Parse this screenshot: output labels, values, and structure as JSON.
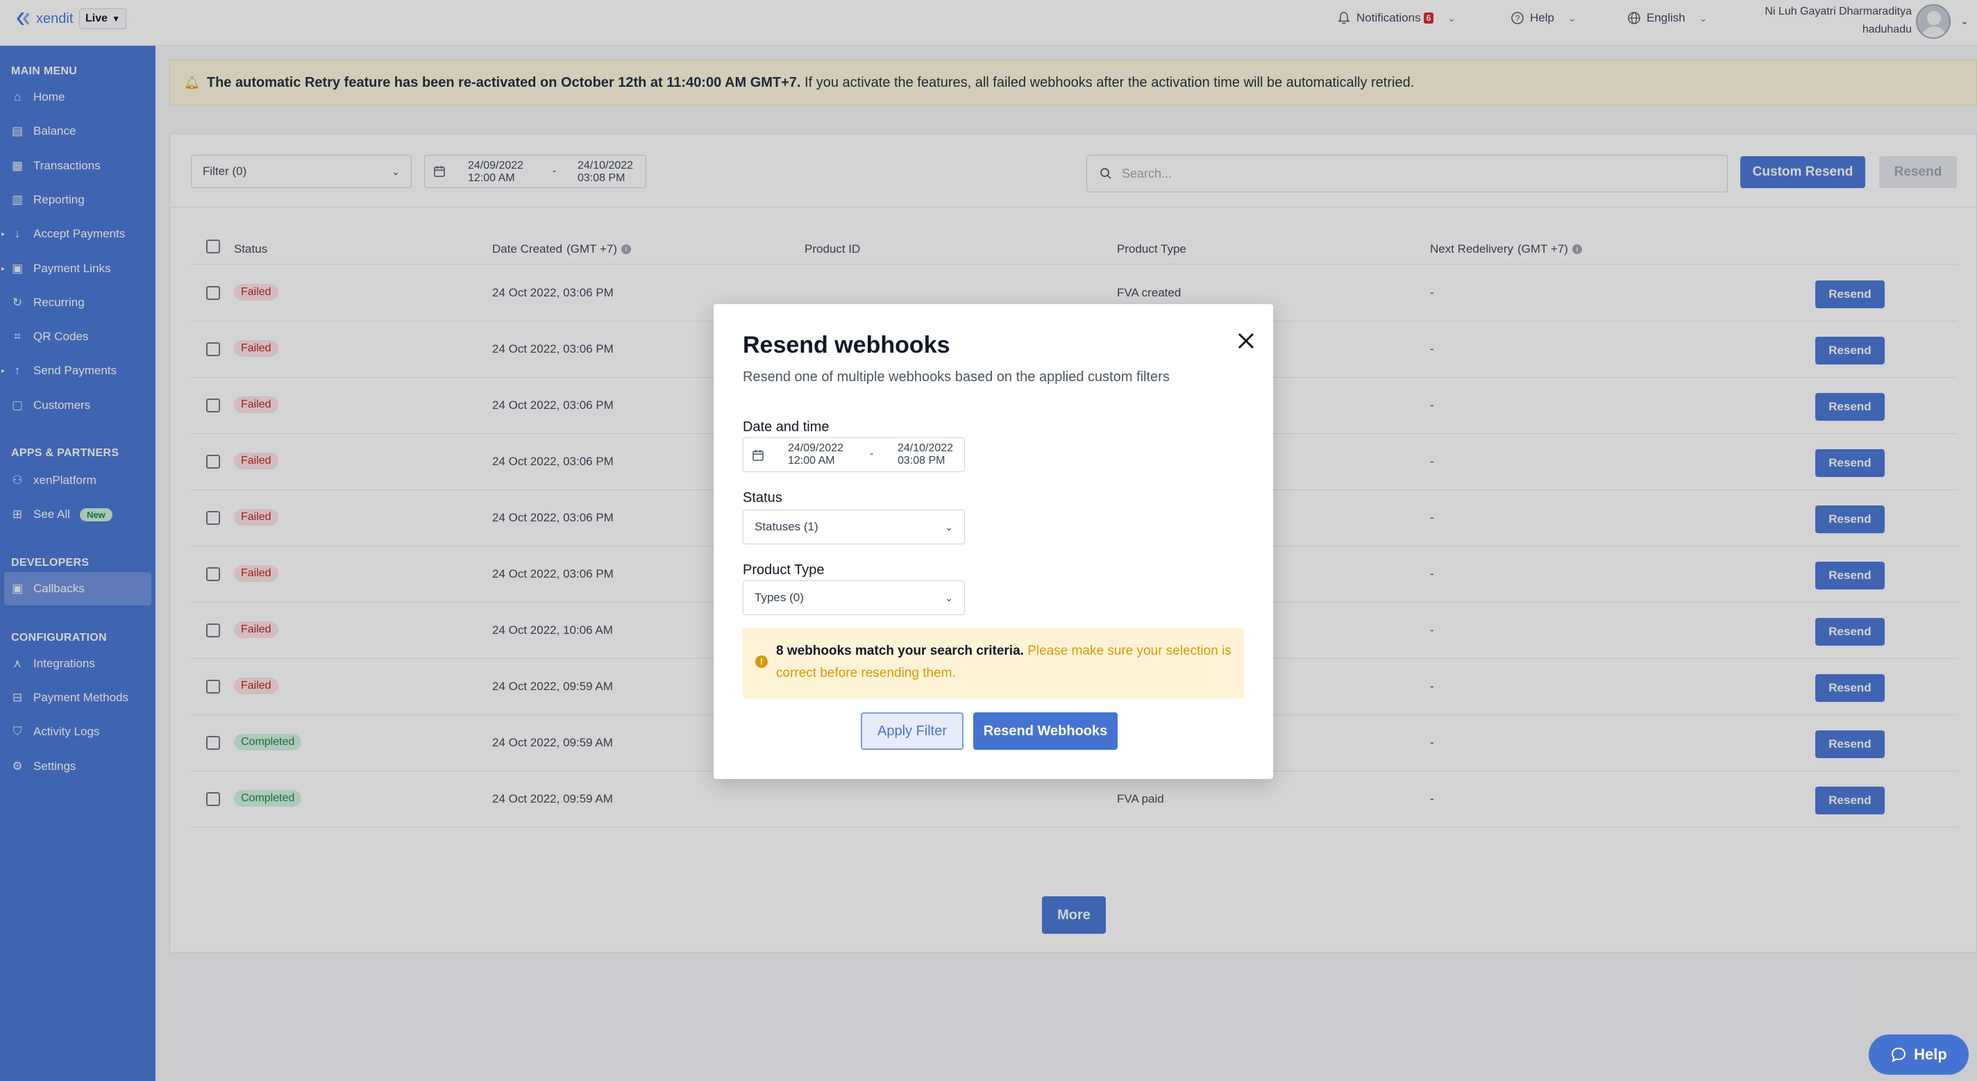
{
  "topbar": {
    "logo_text": "xendit",
    "environment": "Live",
    "notifications_label": "Notifications",
    "notifications_count": "6",
    "help_label": "Help",
    "language_label": "English",
    "user_name": "Ni Luh Gayatri Dharmaraditya",
    "user_handle": "haduhadu"
  },
  "sidebar": {
    "sections": {
      "main_menu": "MAIN MENU",
      "apps_partners": "APPS & PARTNERS",
      "developers": "DEVELOPERS",
      "configuration": "CONFIGURATION"
    },
    "items": {
      "home": "Home",
      "balance": "Balance",
      "transactions": "Transactions",
      "reporting": "Reporting",
      "accept_payments": "Accept Payments",
      "payment_links": "Payment Links",
      "recurring": "Recurring",
      "qr_codes": "QR Codes",
      "send_payments": "Send Payments",
      "customers": "Customers",
      "xenplatform": "xenPlatform",
      "see_all": "See All",
      "see_all_badge": "New",
      "callbacks": "Callbacks",
      "integrations": "Integrations",
      "payment_methods": "Payment Methods",
      "activity_logs": "Activity Logs",
      "settings": "Settings"
    },
    "accent_color": "#4573d2"
  },
  "banner": {
    "bold_text": "The automatic Retry feature has been re-activated on October 12th at 11:40:00 AM GMT+7.",
    "text": "If you activate the features, all failed webhooks after the activation time will be automatically retried."
  },
  "toolbar": {
    "filter_label": "Filter (0)",
    "date_from": "24/09/2022",
    "time_from": "12:00 AM",
    "date_separator": "-",
    "date_to": "24/10/2022",
    "time_to": "03:08 PM",
    "search_placeholder": "Search...",
    "custom_resend_label": "Custom Resend",
    "resend_label": "Resend"
  },
  "table": {
    "headers": {
      "status": "Status",
      "date_created": "Date Created",
      "date_created_tz": "(GMT +7)",
      "product_id": "Product ID",
      "product_type": "Product Type",
      "next_redelivery": "Next Redelivery",
      "next_redelivery_tz": "(GMT +7)"
    },
    "rows": [
      {
        "status": "Failed",
        "date": "24 Oct 2022, 03:06 PM",
        "product_type": "FVA created",
        "next": "-",
        "action": "Resend"
      },
      {
        "status": "Failed",
        "date": "24 Oct 2022, 03:06 PM",
        "product_type": "",
        "next": "-",
        "action": "Resend"
      },
      {
        "status": "Failed",
        "date": "24 Oct 2022, 03:06 PM",
        "product_type": "",
        "next": "-",
        "action": "Resend"
      },
      {
        "status": "Failed",
        "date": "24 Oct 2022, 03:06 PM",
        "product_type": "",
        "next": "-",
        "action": "Resend"
      },
      {
        "status": "Failed",
        "date": "24 Oct 2022, 03:06 PM",
        "product_type": "",
        "next": "-",
        "action": "Resend"
      },
      {
        "status": "Failed",
        "date": "24 Oct 2022, 03:06 PM",
        "product_type": "",
        "next": "-",
        "action": "Resend"
      },
      {
        "status": "Failed",
        "date": "24 Oct 2022, 10:06 AM",
        "product_type": "",
        "next": "-",
        "action": "Resend"
      },
      {
        "status": "Failed",
        "date": "24 Oct 2022, 09:59 AM",
        "product_type": "",
        "next": "-",
        "action": "Resend"
      },
      {
        "status": "Completed",
        "date": "24 Oct 2022, 09:59 AM",
        "product_type": "",
        "next": "-",
        "action": "Resend"
      },
      {
        "status": "Completed",
        "date": "24 Oct 2022, 09:59 AM",
        "product_type": "FVA paid",
        "next": "-",
        "action": "Resend"
      }
    ],
    "more_label": "More"
  },
  "modal": {
    "title": "Resend webhooks",
    "subtitle": "Resend one of multiple webhooks based on the applied custom filters",
    "date_label": "Date and time",
    "date_from": "24/09/2022",
    "time_from": "12:00 AM",
    "date_separator": "-",
    "date_to": "24/10/2022",
    "time_to": "03:08 PM",
    "status_label": "Status",
    "status_value": "Statuses (1)",
    "product_type_label": "Product Type",
    "product_type_value": "Types (0)",
    "alert_bold": "8 webhooks match your search criteria.",
    "alert_text": "Please make sure your selection is correct before resending them.",
    "apply_filter_label": "Apply Filter",
    "resend_webhooks_label": "Resend Webhooks"
  },
  "help_fab": {
    "label": "Help"
  }
}
